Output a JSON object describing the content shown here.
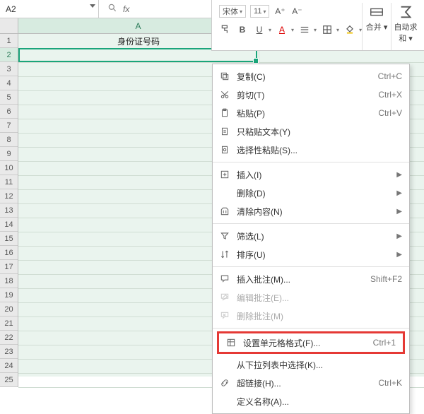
{
  "formula_bar": {
    "cell_ref": "A2",
    "fx_label": "fx"
  },
  "ribbon": {
    "font_name": "宋体",
    "font_size": "11",
    "merge_label": "合并 ▾",
    "autosum_label": "自动求和 ▾"
  },
  "sheet": {
    "column_A_label": "A",
    "row1_value": "身份证号码",
    "row_numbers": [
      "1",
      "2",
      "3",
      "4",
      "5",
      "6",
      "7",
      "8",
      "9",
      "10",
      "11",
      "12",
      "13",
      "14",
      "15",
      "16",
      "17",
      "18",
      "19",
      "20",
      "21",
      "22",
      "23",
      "24",
      "25"
    ],
    "selected_row": 2
  },
  "context_menu": {
    "items": [
      {
        "icon": "copy",
        "label": "复制(C)",
        "shortcut": "Ctrl+C"
      },
      {
        "icon": "cut",
        "label": "剪切(T)",
        "shortcut": "Ctrl+X"
      },
      {
        "icon": "paste",
        "label": "粘贴(P)",
        "shortcut": "Ctrl+V"
      },
      {
        "icon": "ptext",
        "label": "只粘贴文本(Y)",
        "shortcut": ""
      },
      {
        "icon": "pspec",
        "label": "选择性粘贴(S)...",
        "shortcut": ""
      },
      {
        "sep": true
      },
      {
        "icon": "insert",
        "label": "插入(I)",
        "submenu": true
      },
      {
        "icon": "",
        "label": "删除(D)",
        "submenu": true
      },
      {
        "icon": "clear",
        "label": "清除内容(N)",
        "submenu": true
      },
      {
        "sep": true
      },
      {
        "icon": "filter",
        "label": "筛选(L)",
        "submenu": true
      },
      {
        "icon": "sort",
        "label": "排序(U)",
        "submenu": true
      },
      {
        "sep": true
      },
      {
        "icon": "comment",
        "label": "插入批注(M)...",
        "shortcut": "Shift+F2"
      },
      {
        "icon": "editc",
        "label": "编辑批注(E)...",
        "shortcut": "",
        "disabled": true
      },
      {
        "icon": "delc",
        "label": "删除批注(M)",
        "shortcut": "",
        "disabled": true
      },
      {
        "sep": true
      },
      {
        "icon": "format",
        "label": "设置单元格格式(F)...",
        "shortcut": "Ctrl+1",
        "highlight": true
      },
      {
        "icon": "",
        "label": "从下拉列表中选择(K)...",
        "shortcut": ""
      },
      {
        "icon": "link",
        "label": "超链接(H)...",
        "shortcut": "Ctrl+K"
      },
      {
        "icon": "",
        "label": "定义名称(A)...",
        "shortcut": ""
      }
    ]
  }
}
